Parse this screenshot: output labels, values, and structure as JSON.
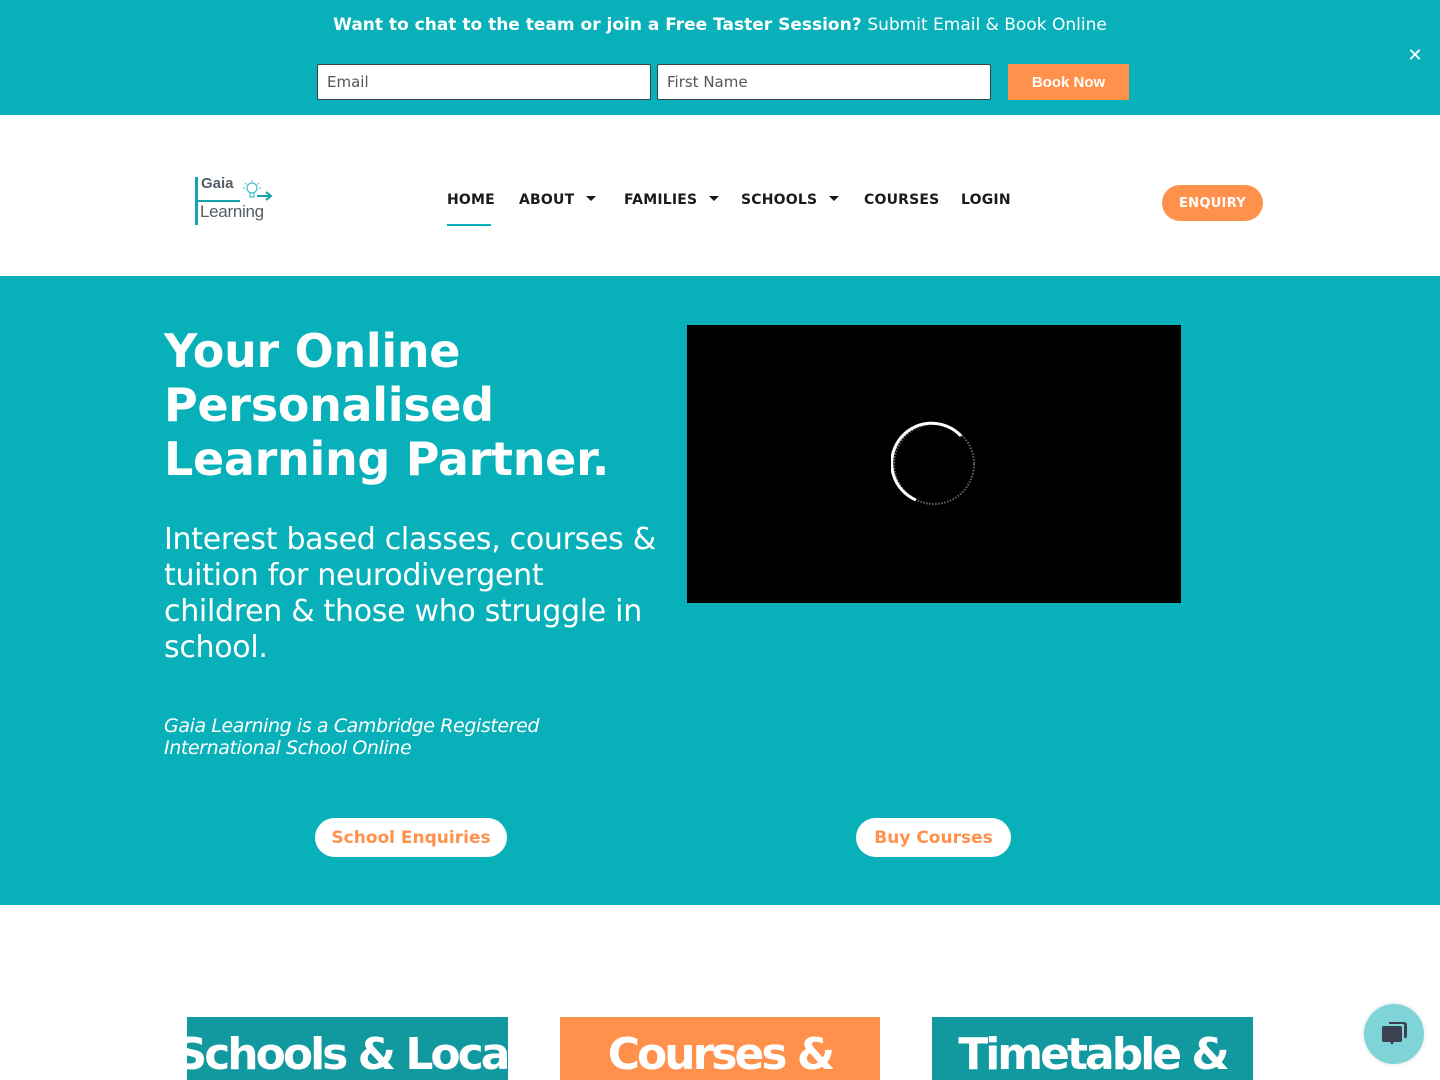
{
  "colors": {
    "brand_teal": "#08b1b9",
    "card_teal": "#12999f",
    "accent_orange": "#ff914d",
    "text_dark": "#1a1a1a",
    "white": "#ffffff"
  },
  "banner": {
    "headline_bold": "Want to chat to the team or join a Free Taster Session?",
    "headline_normal": "Submit Email & Book Online",
    "email_placeholder": "Email",
    "first_name_placeholder": "First Name",
    "book_button": "Book Now",
    "close_icon": "close-icon"
  },
  "header": {
    "logo": {
      "line1": "Gaia",
      "line2": "Learning",
      "icon": "lightbulb-arrow-icon"
    },
    "nav": [
      {
        "label": "HOME",
        "active": true,
        "has_dropdown": false
      },
      {
        "label": "ABOUT",
        "active": false,
        "has_dropdown": true
      },
      {
        "label": "FAMILIES",
        "active": false,
        "has_dropdown": true
      },
      {
        "label": "SCHOOLS",
        "active": false,
        "has_dropdown": true
      },
      {
        "label": "COURSES",
        "active": false,
        "has_dropdown": false
      },
      {
        "label": "LOGIN",
        "active": false,
        "has_dropdown": false
      }
    ],
    "enquiry_button": "ENQUIRY"
  },
  "hero": {
    "title": "Your Online Personalised Learning Partner.",
    "subtitle": "Interest based classes, courses & tuition for neurodivergent children & those who struggle in school.",
    "note": "Gaia Learning is a Cambridge Registered International School Online",
    "video": {
      "state": "loading",
      "icon": "loading-spinner-icon"
    },
    "buttons": {
      "school_enquiries": "School Enquiries",
      "buy_courses": "Buy Courses"
    }
  },
  "cards": [
    {
      "title": "Schools & Local"
    },
    {
      "title": "Courses &"
    },
    {
      "title": "Timetable &"
    }
  ],
  "chat_widget": {
    "icon": "chat-bubbles-icon"
  }
}
